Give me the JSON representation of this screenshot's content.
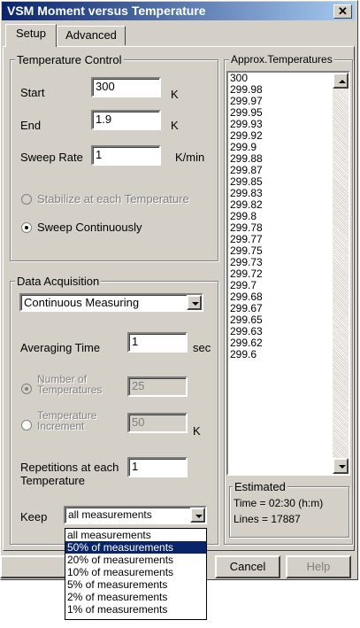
{
  "window": {
    "title": "VSM Moment versus Temperature"
  },
  "tabs": [
    {
      "label": "Setup"
    },
    {
      "label": "Advanced"
    }
  ],
  "temperature_control": {
    "legend": "Temperature Control",
    "start_label": "Start",
    "start_value": "300",
    "start_unit": "K",
    "end_label": "End",
    "end_value": "1.9",
    "end_unit": "K",
    "rate_label": "Sweep Rate",
    "rate_value": "1",
    "rate_unit": "K/min",
    "stabilize_label": "Stabilize at each Temperature",
    "sweep_label": "Sweep Continuously"
  },
  "approx_temps": {
    "legend": "Approx.Temperatures",
    "items": [
      "300",
      "299.98",
      "299.97",
      "299.95",
      "299.93",
      "299.92",
      "299.9",
      "299.88",
      "299.87",
      "299.85",
      "299.83",
      "299.82",
      "299.8",
      "299.78",
      "299.77",
      "299.75",
      "299.73",
      "299.72",
      "299.7",
      "299.68",
      "299.67",
      "299.65",
      "299.63",
      "299.62",
      "299.6"
    ]
  },
  "estimated": {
    "legend": "Estimated",
    "time": "Time = 02:30 (h:m)",
    "lines": "Lines = 17887"
  },
  "data_acquisition": {
    "legend": "Data Acquisition",
    "mode_value": "Continuous Measuring",
    "avg_label": "Averaging Time",
    "avg_value": "1",
    "avg_unit": "sec",
    "num_temps_label_1": "Number of",
    "num_temps_label_2": "Temperatures",
    "num_temps_value": "25",
    "temp_inc_label_1": "Temperature",
    "temp_inc_label_2": "Increment",
    "temp_inc_value": "50",
    "temp_inc_unit": "K",
    "reps_label_1": "Repetitions at each",
    "reps_label_2": "Temperature",
    "reps_value": "1",
    "keep_label": "Keep",
    "keep_value": "all measurements",
    "keep_options": [
      "all measurements",
      "50% of measurements",
      "20% of measurements",
      "10% of measurements",
      "5% of measurements",
      "2% of measurements",
      "1% of measurements"
    ]
  },
  "buttons": {
    "cancel": "Cancel",
    "help": "Help"
  },
  "icons": {
    "close": "close-icon",
    "dropdown": "chevron-down-icon",
    "scroll_up": "arrow-up-icon",
    "scroll_down": "arrow-down-icon"
  }
}
